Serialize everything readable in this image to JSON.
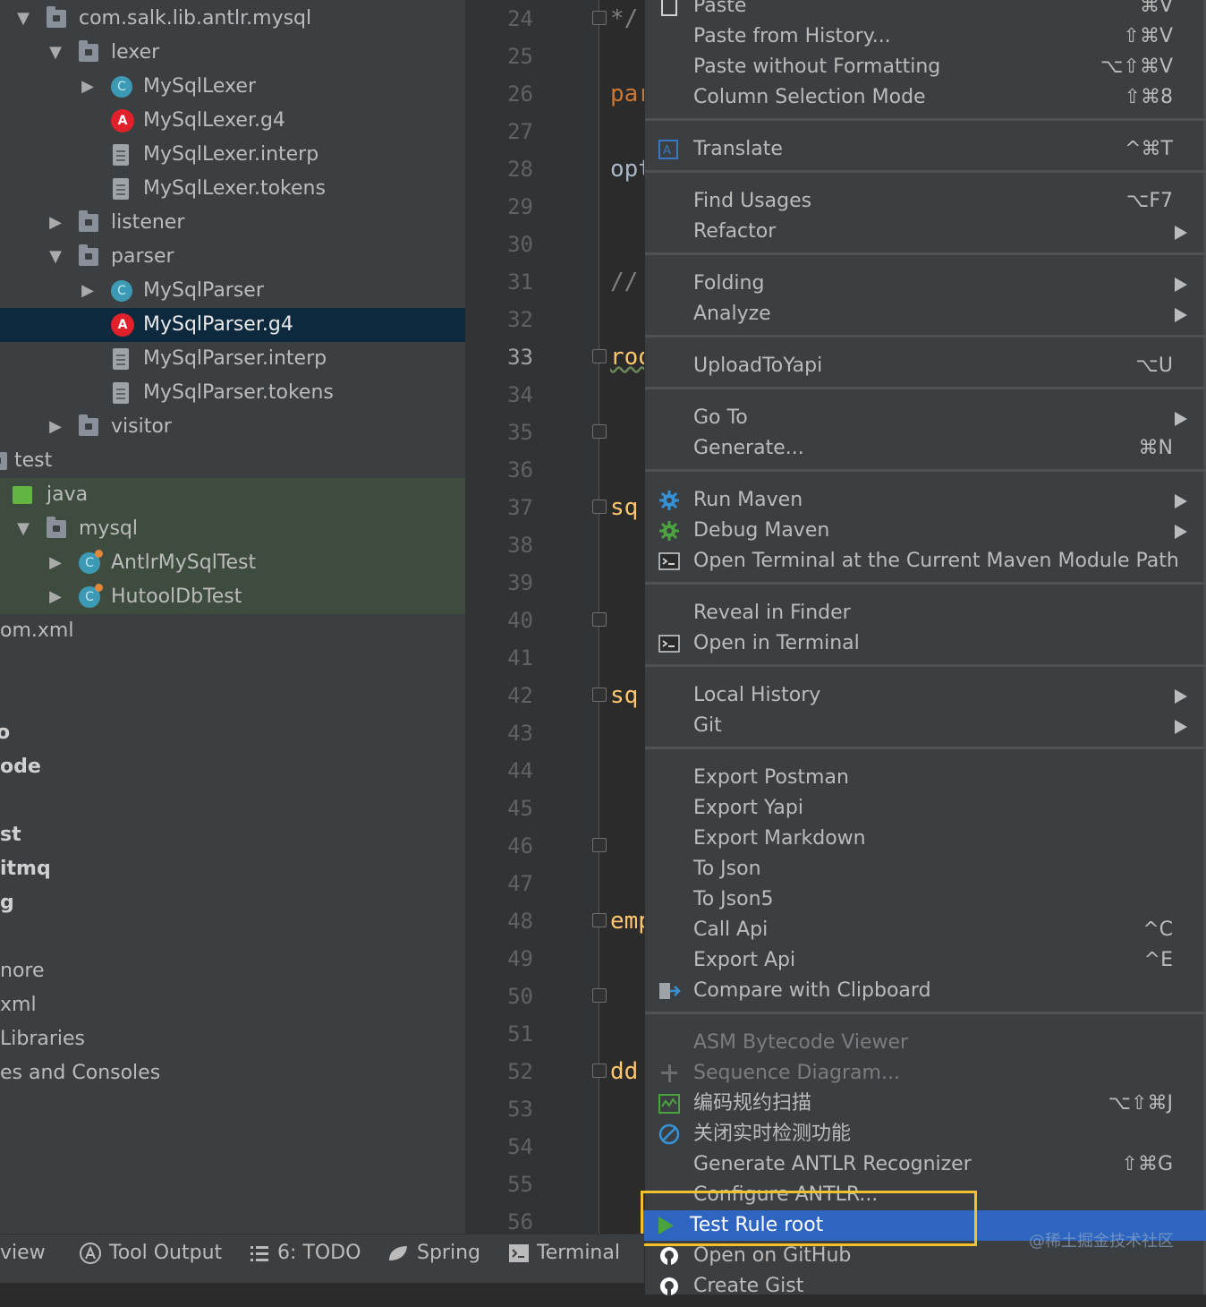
{
  "tree": {
    "items": [
      {
        "label": "com.salk.lib.antlr.mysql",
        "type": "folder",
        "arrow": "▼"
      },
      {
        "label": "lexer",
        "type": "folder",
        "arrow": "▼"
      },
      {
        "label": "MySqlLexer",
        "type": "class",
        "arrow": "▶"
      },
      {
        "label": "MySqlLexer.g4",
        "type": "antlr",
        "arrow": ""
      },
      {
        "label": "MySqlLexer.interp",
        "type": "file",
        "arrow": ""
      },
      {
        "label": "MySqlLexer.tokens",
        "type": "file",
        "arrow": ""
      },
      {
        "label": "listener",
        "type": "folder",
        "arrow": "▶"
      },
      {
        "label": "parser",
        "type": "folder",
        "arrow": "▼"
      },
      {
        "label": "MySqlParser",
        "type": "class",
        "arrow": "▶"
      },
      {
        "label": "MySqlParser.g4",
        "type": "antlr",
        "arrow": ""
      },
      {
        "label": "MySqlParser.interp",
        "type": "file",
        "arrow": ""
      },
      {
        "label": "MySqlParser.tokens",
        "type": "file",
        "arrow": ""
      },
      {
        "label": "visitor",
        "type": "folder",
        "arrow": "▶"
      },
      {
        "label": "test",
        "type": "folder",
        "arrow": ""
      },
      {
        "label": "java",
        "type": "javafolder",
        "arrow": ""
      },
      {
        "label": "mysql",
        "type": "folder",
        "arrow": "▼"
      },
      {
        "label": "AntlrMySqlTest",
        "type": "testclass",
        "arrow": "▶"
      },
      {
        "label": "HutoolDbTest",
        "type": "testclass",
        "arrow": "▶"
      },
      {
        "label": "om.xml",
        "type": "plain",
        "arrow": ""
      },
      {
        "label": "o",
        "type": "plain",
        "arrow": ""
      },
      {
        "label": "ode",
        "type": "plain",
        "arrow": ""
      },
      {
        "label": "st",
        "type": "plain",
        "arrow": ""
      },
      {
        "label": "itmq",
        "type": "plain",
        "arrow": ""
      },
      {
        "label": "g",
        "type": "plain",
        "arrow": ""
      },
      {
        "label": "nore",
        "type": "plain",
        "arrow": ""
      },
      {
        "label": "xml",
        "type": "plain",
        "arrow": ""
      },
      {
        "label": "Libraries",
        "type": "plain",
        "arrow": ""
      },
      {
        "label": "es and Consoles",
        "type": "plain",
        "arrow": ""
      }
    ]
  },
  "editor": {
    "line_numbers": [
      "24",
      "25",
      "26",
      "27",
      "28",
      "29",
      "30",
      "31",
      "32",
      "33",
      "34",
      "35",
      "36",
      "37",
      "38",
      "39",
      "40",
      "41",
      "42",
      "43",
      "44",
      "45",
      "46",
      "47",
      "48",
      "49",
      "50",
      "51",
      "52",
      "53",
      "54",
      "55",
      "56"
    ],
    "current_line": "33",
    "code": [
      {
        "text": "*/",
        "color": "#808080"
      },
      {
        "text": "par",
        "color": "#cc7832"
      },
      {
        "text": "opt",
        "color": "#a9b7c6"
      },
      {
        "text": "//",
        "color": "#808080"
      },
      {
        "text": "roo",
        "color": "#ffc66d"
      },
      {
        "text": "sq",
        "color": "#ffc66d"
      },
      {
        "text": "sq",
        "color": "#ffc66d"
      },
      {
        "text": "emp",
        "color": "#ffc66d"
      },
      {
        "text": "dd",
        "color": "#ffc66d"
      }
    ]
  },
  "menu": {
    "items": [
      {
        "label": "Paste",
        "shortcut": "⌘V",
        "icon": "paste-icon"
      },
      {
        "label": "Paste from History...",
        "shortcut": "⇧⌘V"
      },
      {
        "label": "Paste without Formatting",
        "shortcut": "⌥⇧⌘V"
      },
      {
        "label": "Column Selection Mode",
        "shortcut": "⇧⌘8"
      },
      {
        "label": "Translate",
        "shortcut": "^⌘T",
        "icon": "translate-icon"
      },
      {
        "label": "Find Usages",
        "shortcut": "⌥F7"
      },
      {
        "label": "Refactor",
        "submenu": true
      },
      {
        "label": "Folding",
        "submenu": true
      },
      {
        "label": "Analyze",
        "submenu": true
      },
      {
        "label": "UploadToYapi",
        "shortcut": "⌥U"
      },
      {
        "label": "Go To",
        "submenu": true
      },
      {
        "label": "Generate...",
        "shortcut": "⌘N"
      },
      {
        "label": "Run Maven",
        "submenu": true,
        "icon": "maven-run-icon"
      },
      {
        "label": "Debug Maven",
        "submenu": true,
        "icon": "maven-debug-icon"
      },
      {
        "label": "Open Terminal at the Current Maven Module Path",
        "icon": "terminal-icon"
      },
      {
        "label": "Reveal in Finder"
      },
      {
        "label": "Open in Terminal",
        "icon": "terminal-icon"
      },
      {
        "label": "Local History",
        "submenu": true
      },
      {
        "label": "Git",
        "submenu": true
      },
      {
        "label": "Export Postman"
      },
      {
        "label": "Export Yapi"
      },
      {
        "label": "Export Markdown"
      },
      {
        "label": "To Json"
      },
      {
        "label": "To Json5"
      },
      {
        "label": "Call Api",
        "shortcut": "^C"
      },
      {
        "label": "Export Api",
        "shortcut": "^E"
      },
      {
        "label": "Compare with Clipboard",
        "icon": "compare-icon"
      },
      {
        "label": "ASM Bytecode Viewer",
        "disabled": true
      },
      {
        "label": "Sequence Diagram...",
        "disabled": true,
        "icon": "sequence-icon"
      },
      {
        "label": "编码规约扫描",
        "shortcut": "⌥⇧⌘J",
        "icon": "scan-icon"
      },
      {
        "label": "关闭实时检测功能",
        "icon": "disable-icon"
      },
      {
        "label": "Generate ANTLR Recognizer",
        "shortcut": "⇧⌘G"
      },
      {
        "label": "Configure ANTLR..."
      },
      {
        "label": "Test Rule root",
        "highlighted": true,
        "icon": "run-icon"
      },
      {
        "label": "Open on GitHub",
        "icon": "github-icon"
      },
      {
        "label": "Create Gist",
        "icon": "github-icon"
      }
    ]
  },
  "bottombar": {
    "items": [
      {
        "label": "view"
      },
      {
        "label": "Tool Output",
        "icon": "antlr-icon"
      },
      {
        "label": "6: TODO",
        "icon": "list-icon"
      },
      {
        "label": "Spring",
        "icon": "spring-icon"
      },
      {
        "label": "Terminal",
        "icon": "terminal-icon"
      }
    ]
  },
  "watermark": "@稀土掘金技术社区",
  "colors": {
    "highlight": "#2e65c0",
    "callout": "#f2c12e",
    "selection": "#0d293e"
  }
}
